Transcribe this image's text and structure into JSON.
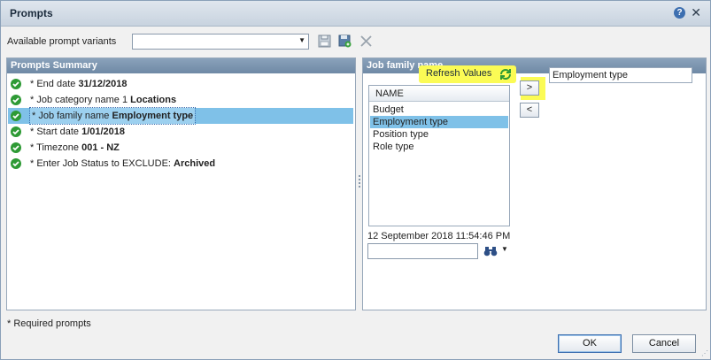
{
  "window": {
    "title": "Prompts"
  },
  "variants": {
    "label": "Available prompt variants",
    "value": ""
  },
  "prompts_summary": {
    "header": "Prompts Summary",
    "rows": [
      {
        "prefix": "* End date ",
        "value": "31/12/2018",
        "selected": false
      },
      {
        "prefix": "* Job category name 1 ",
        "value": "Locations",
        "selected": false
      },
      {
        "prefix": "* Job family name ",
        "value": "Employment type",
        "selected": true
      },
      {
        "prefix": "* Start date ",
        "value": "1/01/2018",
        "selected": false
      },
      {
        "prefix": "* Timezone ",
        "value": "001 - NZ",
        "selected": false
      },
      {
        "prefix": "* Enter Job Status to EXCLUDE: ",
        "value": "Archived",
        "selected": false
      }
    ]
  },
  "job_family": {
    "header": "Job family name",
    "refresh_label": "Refresh Values",
    "list_header": "NAME",
    "items": [
      "Budget",
      "Employment type",
      "Position type",
      "Role type"
    ],
    "selected_item": "Employment type",
    "move_right_label": ">",
    "move_left_label": "<",
    "selected_values": [
      "Employment type"
    ],
    "timestamp": "12 September 2018 11:54:46 PM",
    "search_value": ""
  },
  "footer": {
    "required_note": "* Required prompts",
    "ok_label": "OK",
    "cancel_label": "Cancel"
  },
  "colors": {
    "header_blue": "#7f97b0",
    "selection": "#7fc1e8",
    "highlight": "#fbfb55",
    "check_green": "#2e9a35"
  }
}
